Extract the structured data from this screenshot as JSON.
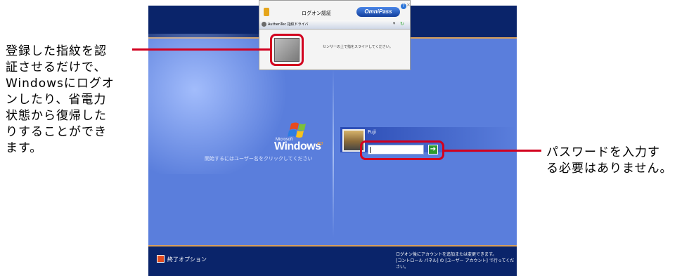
{
  "annotations": {
    "left_lines": [
      "登録した指紋を認",
      "証させるだけで、",
      "Windowsにログオ",
      "ンしたり、省電力",
      "状態から復帰した",
      "りすることができ",
      "ます。"
    ],
    "right_lines": [
      "パスワードを入力す",
      "る必要はありません。"
    ]
  },
  "dialog": {
    "title": "ログオン認証",
    "brand": "OmniPass",
    "help": "?",
    "close": "×",
    "device": "AuthenTec 指紋ドライバ",
    "message": "センサーの上で指をスライドしてください。"
  },
  "login": {
    "logo_microsoft": "Microsoft",
    "logo_text": "Windows",
    "logo_xp": "xp",
    "hint": "開始するにはユーザー名をクリックしてください",
    "user_name": "Fuji",
    "go_symbol": "➔"
  },
  "footer": {
    "shutdown_label": "終了オプション",
    "note_line1": "ログオン後にアカウントを追加または変更できます。",
    "note_line2": "[コントロール パネル] の [ユーザー アカウント] で行ってください。"
  },
  "colors": {
    "accent_red": "#d2001f",
    "xp_blue": "#5a7edc",
    "xp_dark": "#0a246a",
    "xp_orange": "#f7a73a"
  }
}
